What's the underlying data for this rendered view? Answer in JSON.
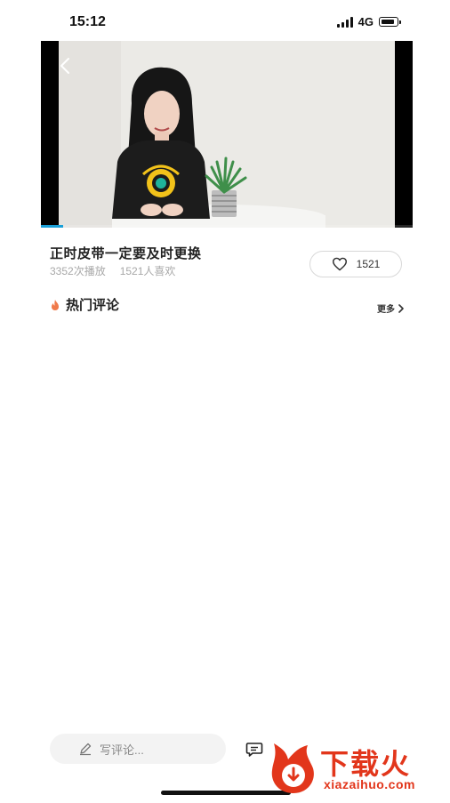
{
  "status_bar": {
    "time": "15:12",
    "network": "4G",
    "icons": [
      "signal-icon",
      "battery-icon"
    ]
  },
  "video": {
    "progress": 0.06,
    "accent_color": "#1aa0d8",
    "icons": [
      "back-arrow-icon"
    ]
  },
  "info": {
    "title": "正时皮带一定要及时更换",
    "plays": "3352次播放",
    "likes_text": "1521人喜欢",
    "like_count": "1521",
    "icons": [
      "heart-icon"
    ]
  },
  "comments": {
    "section_title": "热门评论",
    "more_label": "更多",
    "icons": [
      "fire-icon",
      "chevron-right-icon"
    ]
  },
  "bottom_bar": {
    "input_placeholder": "写评论...",
    "icons": [
      "pen-icon",
      "comment-icon"
    ]
  },
  "watermark": {
    "text": "下载火",
    "subtext": "xiazaihuo.com",
    "color": "#e2361b"
  }
}
